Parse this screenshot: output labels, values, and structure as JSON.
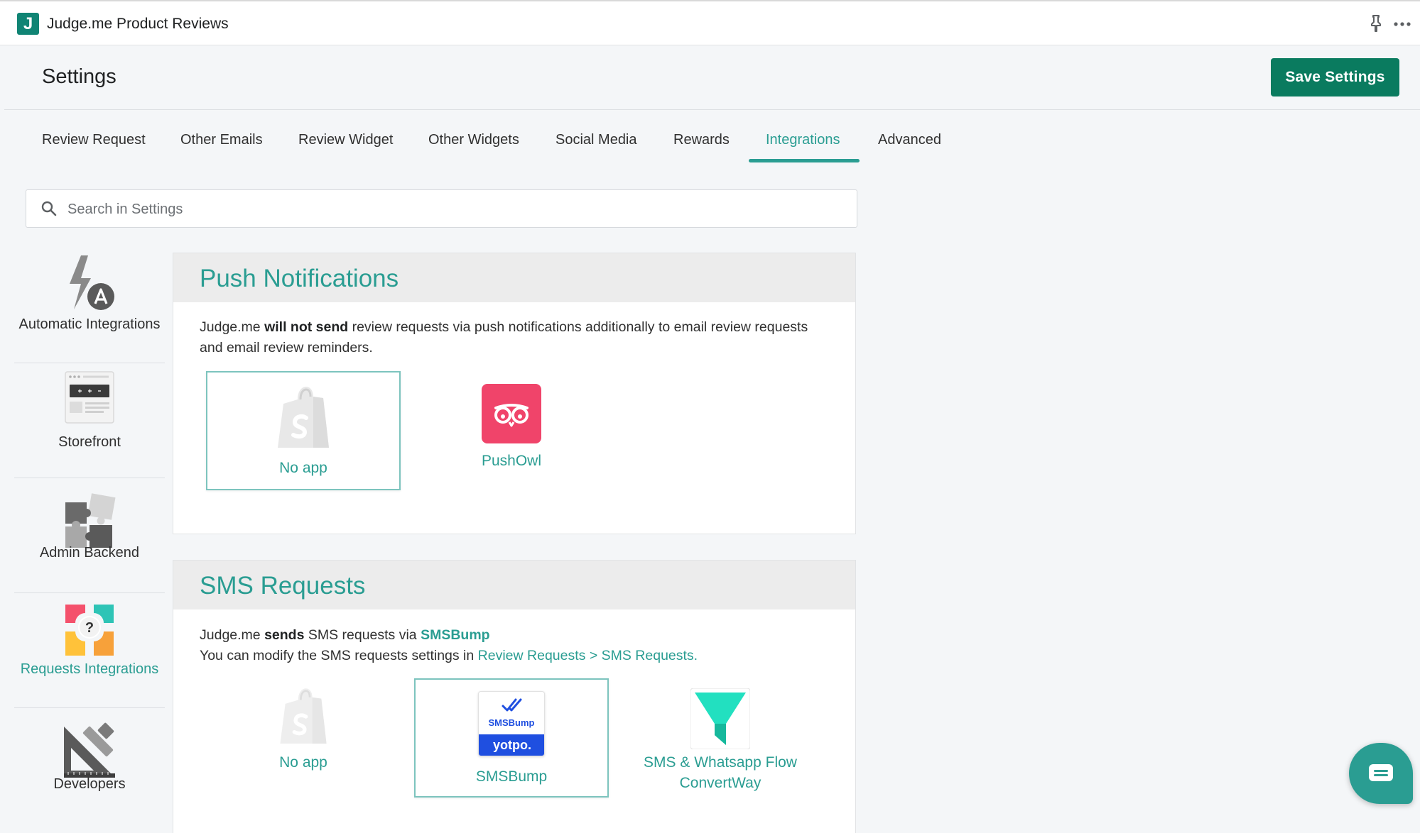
{
  "app": {
    "logo_letter": "J",
    "title": "Judge.me Product Reviews",
    "pin_icon": "pin-icon",
    "more_icon": "more-horizontal-icon"
  },
  "header": {
    "title": "Settings",
    "save_label": "Save Settings"
  },
  "tabs": [
    {
      "label": "Review Request",
      "active": false
    },
    {
      "label": "Other Emails",
      "active": false
    },
    {
      "label": "Review Widget",
      "active": false
    },
    {
      "label": "Other Widgets",
      "active": false
    },
    {
      "label": "Social Media",
      "active": false
    },
    {
      "label": "Rewards",
      "active": false
    },
    {
      "label": "Integrations",
      "active": true
    },
    {
      "label": "Advanced",
      "active": false
    }
  ],
  "search": {
    "placeholder": "Search in Settings",
    "value": ""
  },
  "sidebar": [
    {
      "label": "Automatic Integrations",
      "icon": "lightning-a-icon",
      "active": false
    },
    {
      "label": "Storefront",
      "icon": "storefront-icon",
      "active": false
    },
    {
      "label": "Admin Backend",
      "icon": "puzzle-icon",
      "active": false
    },
    {
      "label": "Requests Integrations",
      "icon": "requests-integrations-icon",
      "active": true
    },
    {
      "label": "Developers",
      "icon": "developer-tools-icon",
      "active": false
    }
  ],
  "push": {
    "title": "Push Notifications",
    "text_pre": "Judge.me ",
    "text_bold": "will not send",
    "text_post": " review requests via push notifications additionally to email review requests and email review reminders.",
    "apps": [
      {
        "label": "No app",
        "icon": "shopify-bag-icon",
        "selected": true
      },
      {
        "label": "PushOwl",
        "icon": "pushowl-icon",
        "selected": false
      }
    ]
  },
  "sms": {
    "title": "SMS Requests",
    "line1_pre": "Judge.me ",
    "line1_bold": "sends",
    "line1_mid": " SMS requests via ",
    "line1_link": "SMSBump",
    "line2_pre": "You can modify the SMS requests settings in ",
    "line2_link": "Review Requests > SMS Requests.",
    "apps": [
      {
        "label": "No app",
        "icon": "shopify-bag-icon",
        "selected": false
      },
      {
        "label": "SMSBump",
        "icon": "smsbump-yotpo-icon",
        "selected": true,
        "logo_top": "SMSBump",
        "logo_bottom": "yotpo."
      },
      {
        "label": "SMS & Whatsapp Flow",
        "label2": "ConvertWay",
        "icon": "convertway-funnel-icon",
        "selected": false
      }
    ]
  },
  "chat": {
    "icon": "chat-bubble-icon"
  },
  "colors": {
    "accent": "#2a9d92",
    "save_button": "#0a7b5f",
    "pushowl": "#f0446a",
    "convertway": "#22e0c0",
    "smsbump_blue": "#1f4fe0"
  }
}
